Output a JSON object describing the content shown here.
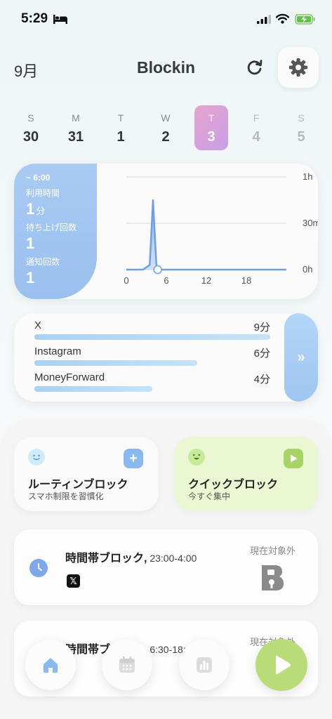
{
  "status_bar": {
    "time": "5:29"
  },
  "header": {
    "month": "9月",
    "title": "Blockin"
  },
  "week": [
    {
      "dow": "S",
      "num": "30",
      "state": "past"
    },
    {
      "dow": "M",
      "num": "31",
      "state": "past"
    },
    {
      "dow": "T",
      "num": "1",
      "state": "past"
    },
    {
      "dow": "W",
      "num": "2",
      "state": "past"
    },
    {
      "dow": "T",
      "num": "3",
      "state": "selected"
    },
    {
      "dow": "F",
      "num": "4",
      "state": "future"
    },
    {
      "dow": "S",
      "num": "5",
      "state": "future"
    }
  ],
  "usage": {
    "range": "~ 6:00",
    "screen_time_label": "利用時間",
    "screen_time_value": "1",
    "screen_time_unit": "分",
    "pickups_label": "持ち上げ回数",
    "pickups_value": "1",
    "notifications_label": "通知回数",
    "notifications_value": "1"
  },
  "chart_data": {
    "type": "line",
    "x_ticks": [
      "0",
      "6",
      "12",
      "18"
    ],
    "y_ticks": [
      "1h",
      "30m",
      "0h"
    ],
    "xlim": [
      0,
      24
    ],
    "ylim_minutes": [
      0,
      60
    ],
    "x": [
      0,
      2.5,
      3.5,
      4.0,
      4.5,
      5.0,
      6.0,
      24
    ],
    "values": [
      0,
      0,
      3,
      45,
      3,
      0,
      0,
      0
    ],
    "marker_x": 4.7
  },
  "apps": [
    {
      "name": "X",
      "minutes": "9分",
      "fraction": 1.0
    },
    {
      "name": "Instagram",
      "minutes": "6分",
      "fraction": 0.69
    },
    {
      "name": "MoneyForward",
      "minutes": "4分",
      "fraction": 0.5
    }
  ],
  "more_label": "»",
  "routine_block": {
    "title": "ルーティンブロック",
    "subtitle": "スマホ制限を習慣化",
    "action": "+"
  },
  "quick_block": {
    "title": "クイックブロック",
    "subtitle": "今すぐ集中"
  },
  "schedules": [
    {
      "title": "時間帯ブロック,",
      "time": " 23:00-4:00",
      "status": "現在対象外",
      "app": "𝕏"
    },
    {
      "title": "時間帯ブロック,",
      "time": " 6:30-18:00",
      "status": "現在対象外"
    }
  ],
  "colors": {
    "accent_blue": "#9ac0f0",
    "selected_day": "#d7a0dc",
    "quick_green": "#b8dd78"
  }
}
